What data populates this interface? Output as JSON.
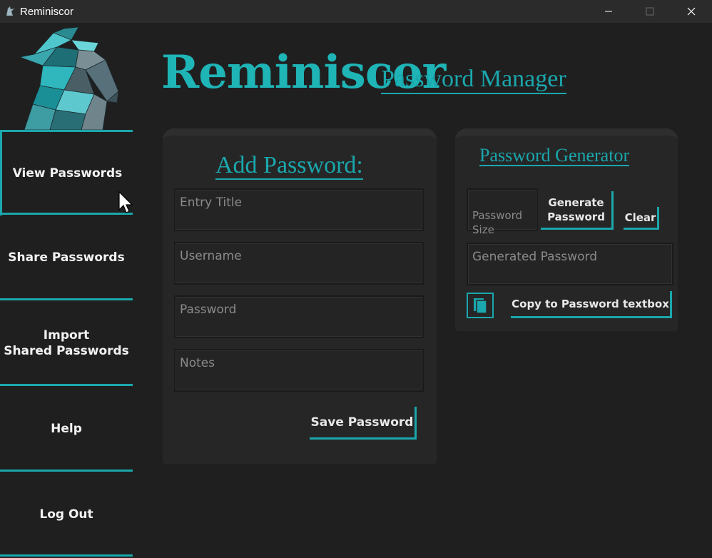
{
  "window": {
    "title": "Reminiscor",
    "minimize_glyph": "—",
    "maximize_glyph": "☐",
    "close_glyph": "✕"
  },
  "sidebar": {
    "items": [
      {
        "label": "View Passwords"
      },
      {
        "label": "Share Passwords"
      },
      {
        "label": "Import\nShared Passwords"
      },
      {
        "label": "Help"
      },
      {
        "label": "Log Out"
      }
    ]
  },
  "header": {
    "brand": "Reminiscor",
    "subtitle": "Password Manager"
  },
  "add_password": {
    "heading": "Add Password:",
    "entry_title_placeholder": "Entry Title",
    "username_placeholder": "Username",
    "password_placeholder": "Password",
    "notes_placeholder": "Notes",
    "save_label": "Save Password"
  },
  "generator": {
    "heading": "Password Generator",
    "size_placeholder": "Password\nSize",
    "generate_label": "Generate\nPassword",
    "clear_label": "Clear",
    "generated_placeholder": "Generated Password",
    "copy_label": "Copy to Password textbox"
  },
  "colors": {
    "accent": "#1aa7ad",
    "background": "#1f1f1f",
    "panel": "#262626"
  },
  "icons": {
    "app": "reminiscor-logo-icon",
    "copy": "copy-icon",
    "cursor": "mouse-cursor-icon"
  }
}
